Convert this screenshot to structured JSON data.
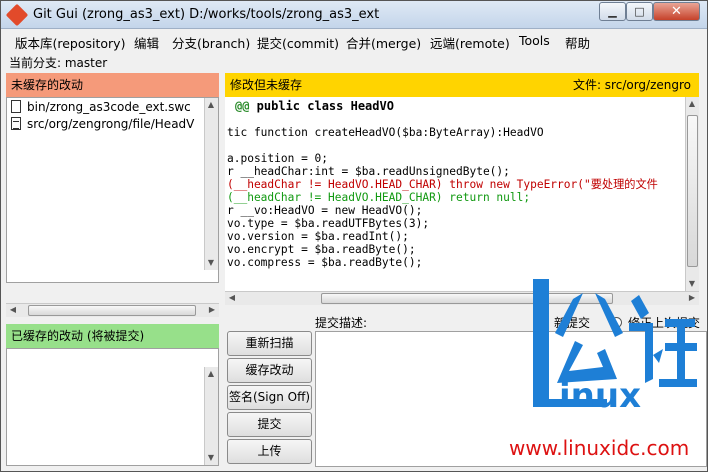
{
  "window": {
    "title": "Git Gui (zrong_as3_ext) D:/works/tools/zrong_as3_ext",
    "controls": {
      "minimize": "▁",
      "maximize": "□",
      "close": "✕"
    }
  },
  "menu": {
    "items": [
      "版本库(repository)",
      "编辑",
      "分支(branch)",
      "提交(commit)",
      "合并(merge)",
      "远端(remote)",
      "Tools",
      "帮助"
    ]
  },
  "branch": {
    "label": "当前分支: master"
  },
  "unstaged": {
    "title": "未缓存的改动",
    "files": [
      {
        "name": "bin/zrong_as3code_ext.swc",
        "icon": "file-icon"
      },
      {
        "name": "src/org/zengrong/file/HeadV",
        "icon": "modified-file-icon"
      }
    ]
  },
  "staged": {
    "title": "已缓存的改动 (将被提交)"
  },
  "diff": {
    "header_left": "修改但未缓存",
    "header_file": "文件:  src/org/zengro",
    "lines": [
      {
        "kind": "hunk",
        "marker": "@@",
        "text": " public class HeadVO"
      },
      {
        "kind": "ctx",
        "text": ""
      },
      {
        "kind": "ctx",
        "text": "tic function createHeadVO($ba:ByteArray):HeadVO"
      },
      {
        "kind": "ctx",
        "text": ""
      },
      {
        "kind": "ctx",
        "text": "a.position = 0;"
      },
      {
        "kind": "ctx",
        "text": "r __headChar:int = $ba.readUnsignedByte();"
      },
      {
        "kind": "rem",
        "text": "(__headChar != HeadVO.HEAD_CHAR) throw new TypeError(\"要处理的文件"
      },
      {
        "kind": "add",
        "text": "(__headChar != HeadVO.HEAD_CHAR) return null;"
      },
      {
        "kind": "ctx",
        "text": "r __vo:HeadVO = new HeadVO();"
      },
      {
        "kind": "ctx",
        "text": "vo.type = $ba.readUTFBytes(3);"
      },
      {
        "kind": "ctx",
        "text": "vo.version = $ba.readInt();"
      },
      {
        "kind": "ctx",
        "text": "vo.encrypt = $ba.readByte();"
      },
      {
        "kind": "ctx",
        "text": "vo.compress = $ba.readByte();"
      }
    ]
  },
  "commit": {
    "desc_label": "提交描述:",
    "radio_new": "新提交",
    "radio_amend": "修正上次提交",
    "buttons": {
      "rescan": "重新扫描",
      "stage": "缓存改动",
      "signoff": "签名(Sign Off)",
      "commit": "提交",
      "push": "上传"
    }
  },
  "watermark": {
    "logo_text": "Linux公社",
    "url": "www.linuxidc.com",
    "brand_color": "#1e7fd6"
  },
  "colors": {
    "unstaged_header": "#f59a7a",
    "staged_header": "#97e08a",
    "diff_header": "#ffd400",
    "removed_line": "#c00000",
    "added_line": "#119911"
  }
}
